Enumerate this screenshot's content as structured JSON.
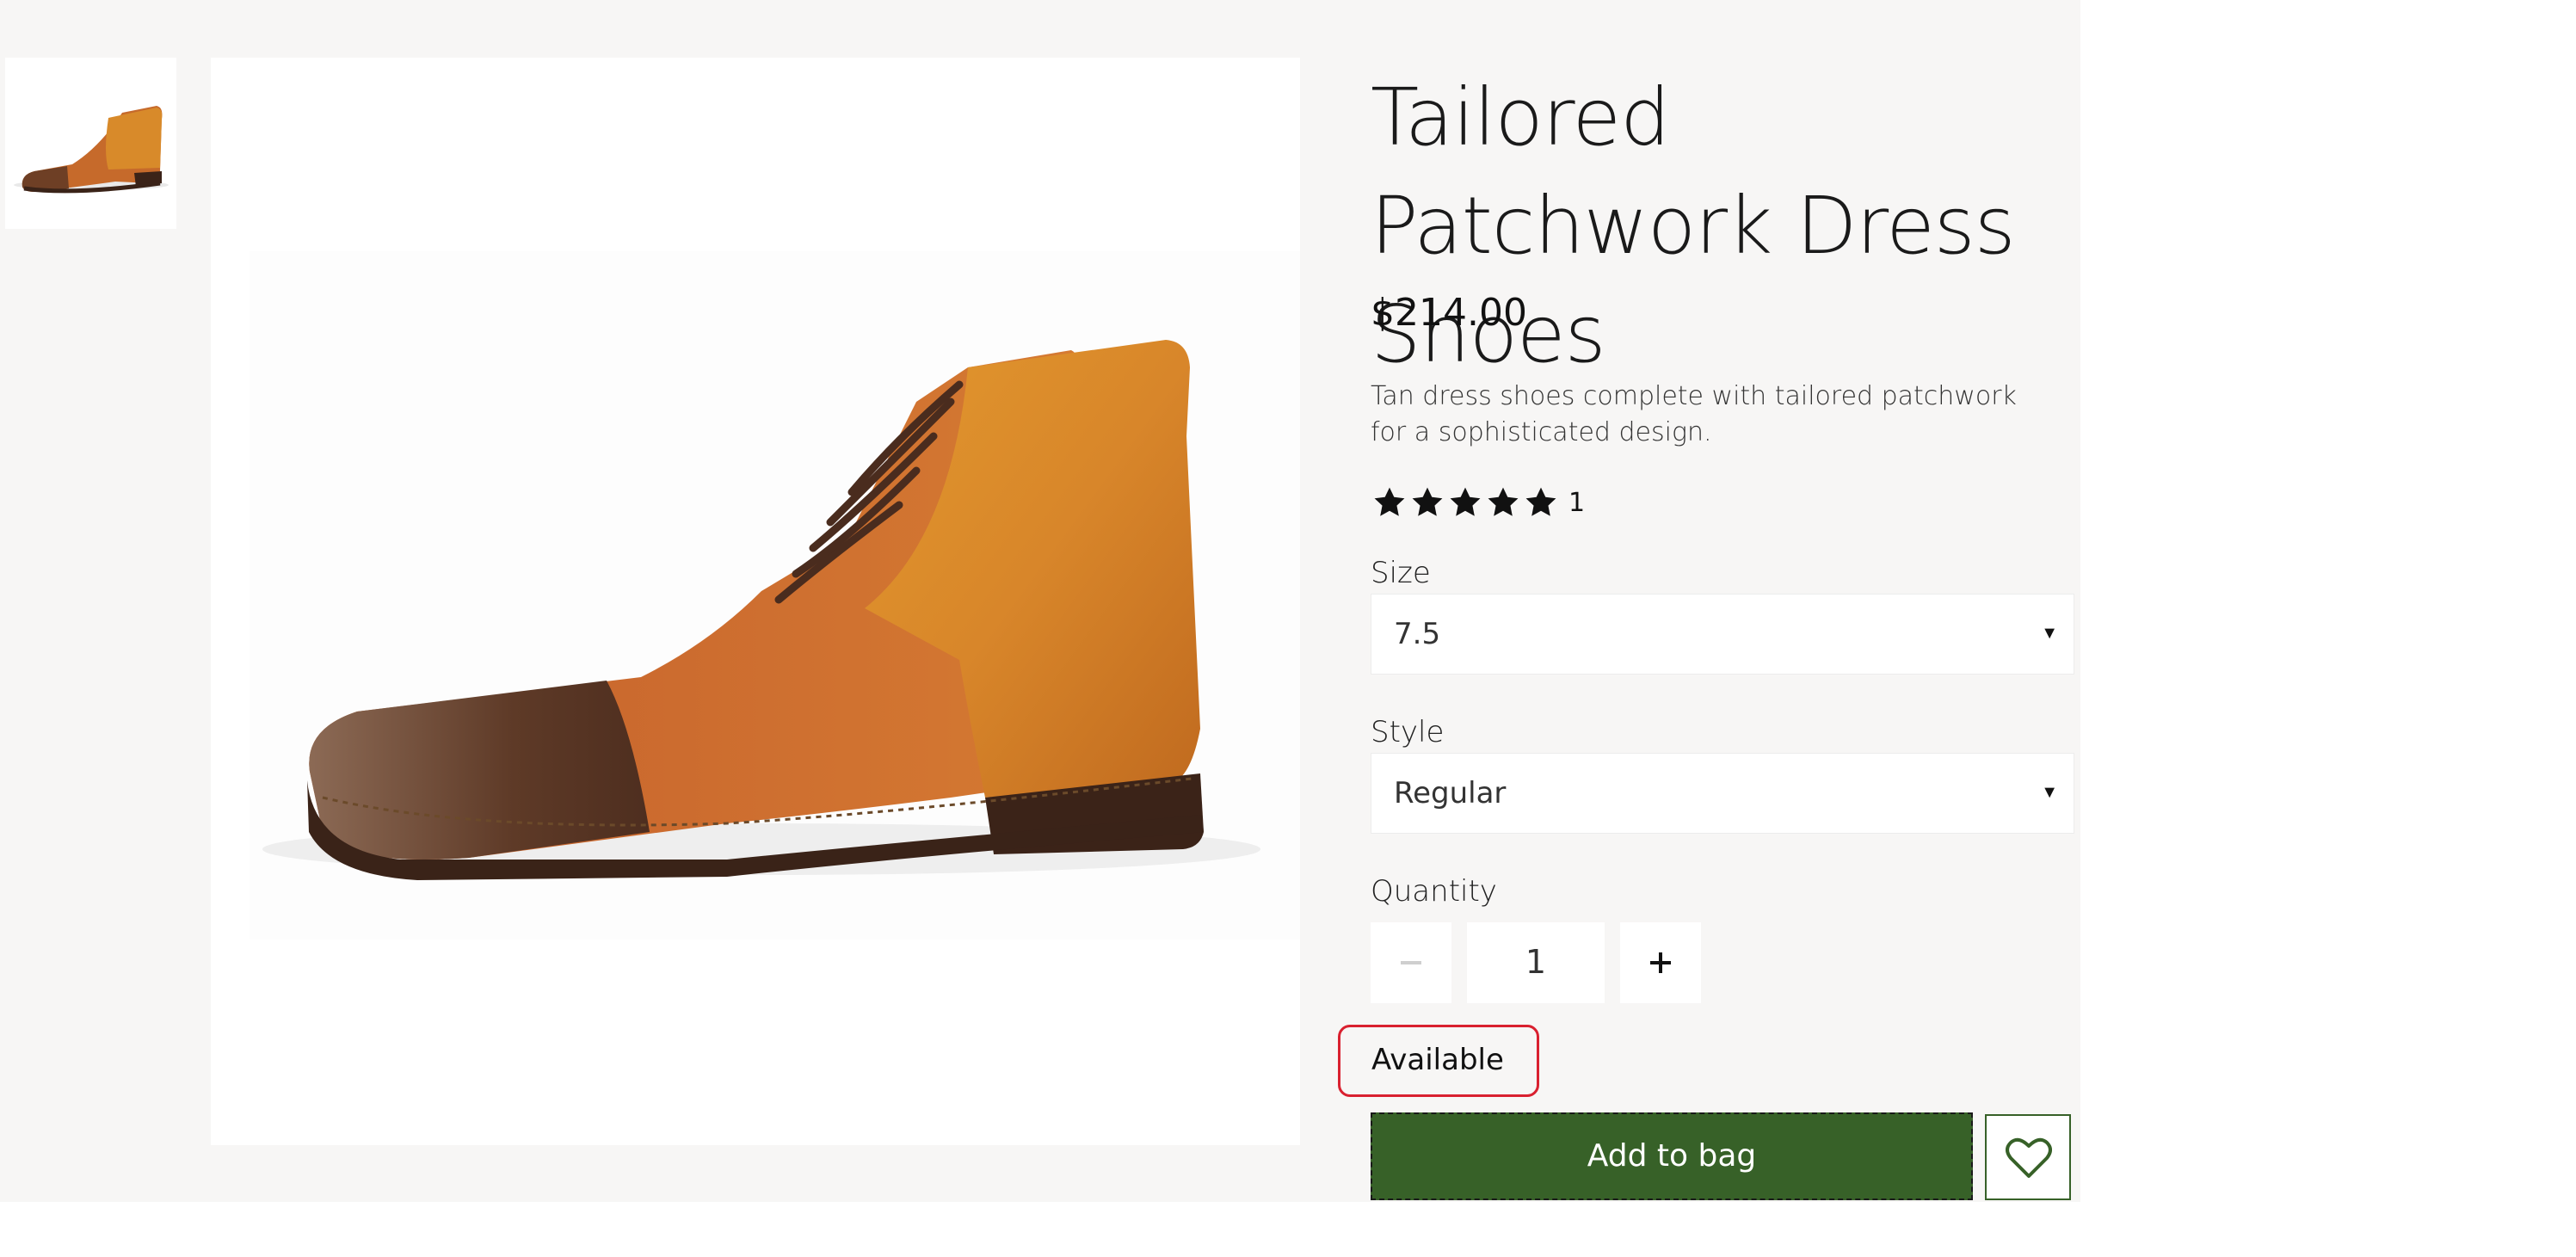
{
  "product": {
    "title": "Tailored Patchwork Dress Shoes",
    "price": "$214.00",
    "description": "Tan dress shoes complete with tailored patchwork for a sophisticated design.",
    "rating": {
      "stars": 5,
      "max_stars": 5,
      "count": "1"
    }
  },
  "options": {
    "size": {
      "label": "Size",
      "selected": "7.5"
    },
    "style": {
      "label": "Style",
      "selected": "Regular"
    }
  },
  "quantity": {
    "label": "Quantity",
    "value": "1"
  },
  "availability": "Available",
  "actions": {
    "add_to_bag": "Add to bag"
  },
  "icons": {
    "star": "star-icon",
    "minus": "minus-icon",
    "plus": "plus-icon",
    "caret": "caret-down-icon",
    "heart": "heart-icon"
  },
  "colors": {
    "primary_green": "#376128",
    "availability_outline": "#d9202f",
    "page_background": "#f7f6f5"
  }
}
